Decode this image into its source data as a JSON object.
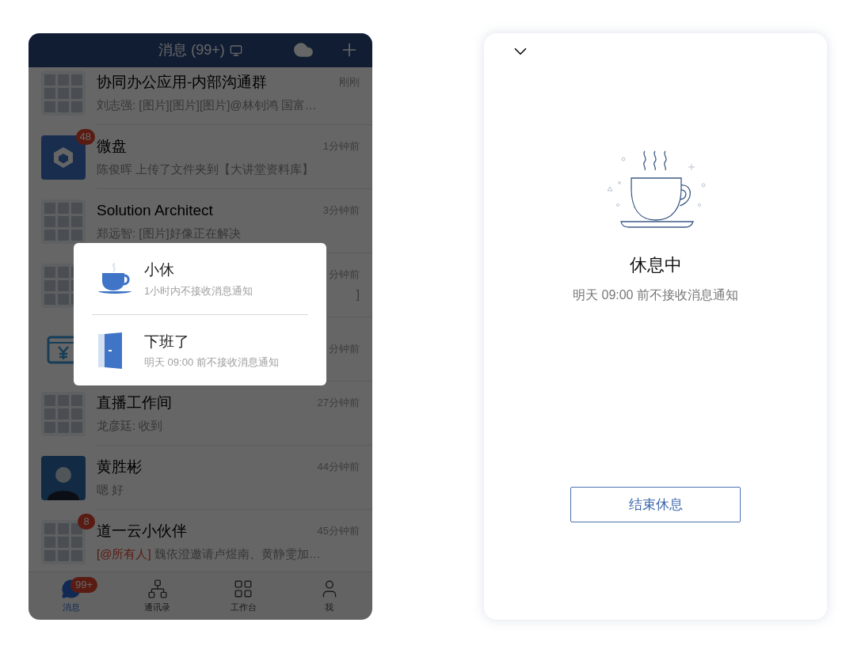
{
  "header": {
    "title": "消息 (99+)"
  },
  "conversations": [
    {
      "kind": "group",
      "title": "协同办公应用-内部沟通群",
      "time": "刚刚",
      "preview": "刘志强: [图片][图片][图片]@林钊鸿 国富…"
    },
    {
      "kind": "drive",
      "badge": "48",
      "title": "微盘",
      "time": "1分钟前",
      "preview": "陈俊晖 上传了文件夹到【大讲堂资料库】"
    },
    {
      "kind": "group",
      "title": "Solution Architect",
      "time": "3分钟前",
      "preview": "郑远智: [图片]好像正在解决"
    },
    {
      "kind": "group",
      "time": "分钟前",
      "preview": "]"
    },
    {
      "kind": "finance",
      "time": "分钟前"
    },
    {
      "kind": "group",
      "title": "直播工作间",
      "time": "27分钟前",
      "preview": "龙彦廷: 收到"
    },
    {
      "kind": "person",
      "title": "黄胜彬",
      "time": "44分钟前",
      "preview": "嗯 好"
    },
    {
      "kind": "group",
      "badge": "8",
      "title": "道一云小伙伴",
      "time": "45分钟前",
      "mention": "[@所有人]",
      "preview": "魏依澄邀请卢煜南、黄静雯加…"
    }
  ],
  "tabs": [
    {
      "kind": "chat",
      "label": "消息",
      "selected": true,
      "badge": "99+"
    },
    {
      "kind": "contacts",
      "label": "通讯录",
      "selected": false
    },
    {
      "kind": "grid",
      "label": "工作台",
      "selected": false
    },
    {
      "kind": "person",
      "label": "我",
      "selected": false
    }
  ],
  "popup": {
    "options": [
      {
        "kind": "cup",
        "title": "小休",
        "subtitle": "1小时内不接收消息通知"
      },
      {
        "kind": "door",
        "title": "下班了",
        "subtitle": "明天 09:00 前不接收消息通知"
      }
    ]
  },
  "rest_panel": {
    "title": "休息中",
    "subtitle": "明天 09:00 前不接收消息通知",
    "button": "结束休息"
  }
}
